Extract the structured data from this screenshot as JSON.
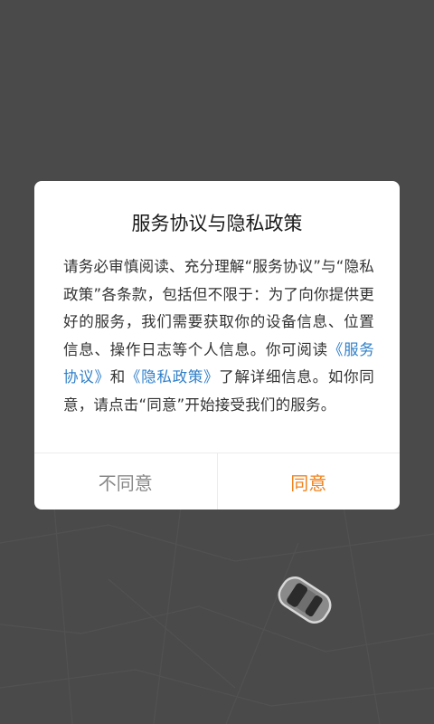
{
  "dialog": {
    "title": "服务协议与隐私政策",
    "body": {
      "part1": "请务必审慎阅读、充分理解“服务协议”与“隐私政策”各条款，包括但不限于：为了向你提供更好的服务，我们需要获取你的设备信息、位置信息、操作日志等个人信息。你可阅读",
      "link_service": "《服务协议》",
      "part2": "和",
      "link_privacy": "《隐私政策》",
      "part3": "了解详细信息。如你同意，请点击“同意”开始接受我们的服务。"
    },
    "buttons": {
      "disagree": "不同意",
      "agree": "同意"
    }
  },
  "icons": {
    "car": "car-icon"
  },
  "colors": {
    "overlay": "#4a4a4a",
    "link": "#2f7fc9",
    "accent": "#f0831e",
    "disagree": "#888888"
  }
}
